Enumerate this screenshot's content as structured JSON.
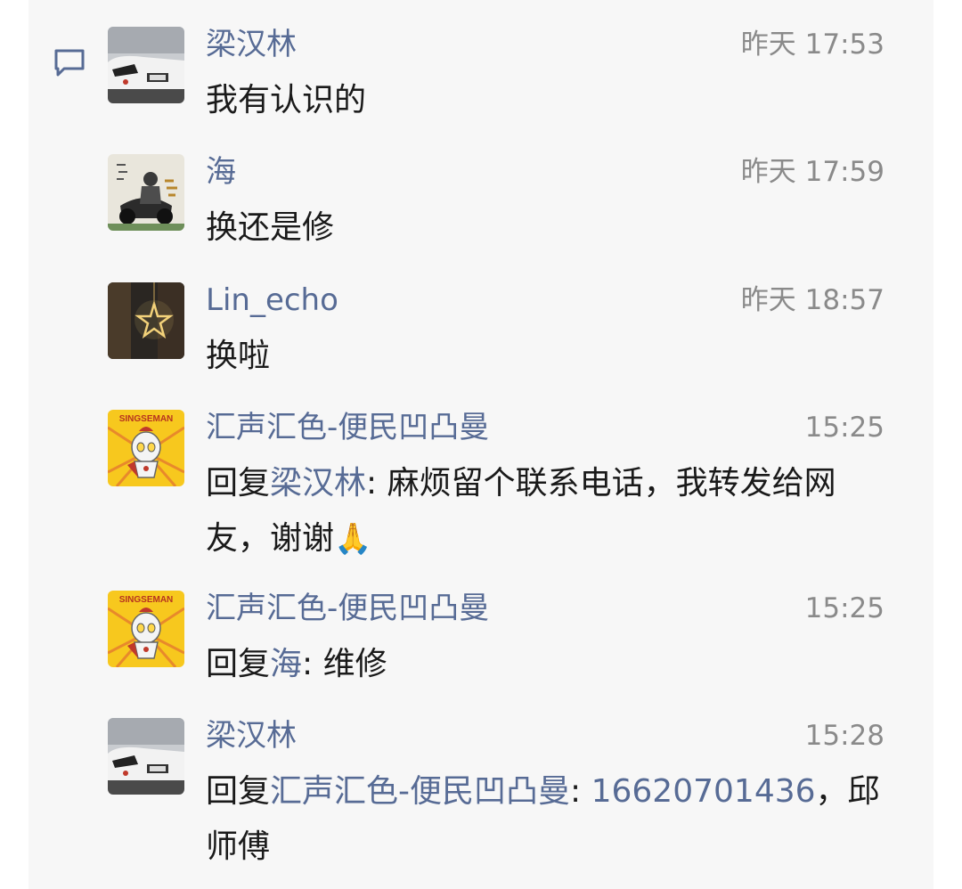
{
  "comments": [
    {
      "name": "梁汉林",
      "time": "昨天 17:53",
      "text": "我有认识的"
    },
    {
      "name": "海",
      "time": "昨天 17:59",
      "text": "换还是修"
    },
    {
      "name": "Lin_echo",
      "time": "昨天 18:57",
      "text": "换啦"
    },
    {
      "name": "汇声汇色-便民凹凸曼",
      "time": "15:25",
      "reply_prefix": "回复",
      "reply_to": "梁汉林",
      "colon": ": ",
      "text": "麻烦留个联系电话，我转发给网友，谢谢",
      "emoji": "🙏"
    },
    {
      "name": "汇声汇色-便民凹凸曼",
      "time": "15:25",
      "reply_prefix": "回复",
      "reply_to": "海",
      "colon": ": ",
      "text": "维修"
    },
    {
      "name": "梁汉林",
      "time": "15:28",
      "reply_prefix": "回复",
      "reply_to": "汇声汇色-便民凹凸曼",
      "colon": ": ",
      "phone": "16620701436",
      "text": "，邱师傅"
    }
  ],
  "avatar_text": {
    "singseman": "SINGSEMAN"
  },
  "icons": {
    "comment": "comment-bubble-icon"
  },
  "colors": {
    "name": "#576b95",
    "time": "#8a8a8a",
    "text": "#1a1a1a",
    "background": "#f7f7f7"
  }
}
